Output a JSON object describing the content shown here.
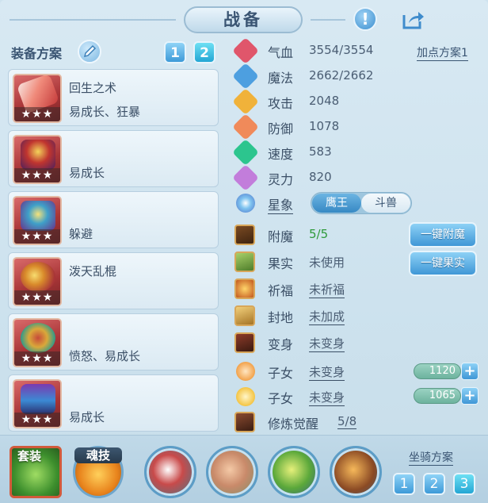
{
  "header": {
    "title": "战备"
  },
  "equipment": {
    "label": "装备方案",
    "tabs": [
      "1",
      "2"
    ],
    "active_tab": "2",
    "items": [
      {
        "name": "回生之术",
        "traits": "易成长、狂暴",
        "stars": "★★★"
      },
      {
        "name": "",
        "traits": "易成长",
        "stars": "★★★"
      },
      {
        "name": "",
        "traits": "躲避",
        "stars": "★★★"
      },
      {
        "name": "泼天乱棍",
        "traits": "",
        "stars": "★★★"
      },
      {
        "name": "",
        "traits": "愤怒、易成长",
        "stars": "★★★"
      },
      {
        "name": "",
        "traits": "易成长",
        "stars": "★★★"
      }
    ]
  },
  "stats": {
    "plan_link": "加点方案1",
    "rows": [
      {
        "name": "气血",
        "value": "3554/3554",
        "icon": "heart-icon",
        "color": "#e0566b"
      },
      {
        "name": "魔法",
        "value": "2662/2662",
        "icon": "mana-icon",
        "color": "#4d9fe0"
      },
      {
        "name": "攻击",
        "value": "2048",
        "icon": "sword-icon",
        "color": "#f0b23a"
      },
      {
        "name": "防御",
        "value": "1078",
        "icon": "shield-icon",
        "color": "#f08a5a"
      },
      {
        "name": "速度",
        "value": "583",
        "icon": "speed-icon",
        "color": "#2cc58e"
      },
      {
        "name": "灵力",
        "value": "820",
        "icon": "spirit-icon",
        "color": "#c27ddb"
      }
    ],
    "constellation": {
      "label": "星象",
      "options": [
        "鹰王",
        "斗兽"
      ],
      "selected": "鹰王"
    }
  },
  "enhance": {
    "rows": [
      {
        "name": "附魔",
        "value": "5/5"
      },
      {
        "name": "果实",
        "value": "未使用"
      },
      {
        "name": "祈福",
        "value": "未祈福"
      },
      {
        "name": "封地",
        "value": "未加成"
      },
      {
        "name": "变身",
        "value": "未变身"
      },
      {
        "name": "子女",
        "value": "未变身"
      },
      {
        "name": "子女",
        "value": "未变身"
      },
      {
        "name": "修炼觉醒",
        "value": "5/8"
      }
    ],
    "buttons": {
      "enchant_all": "一键附魔",
      "fruit_all": "一键果实"
    },
    "child_values": [
      "1120",
      "1065"
    ],
    "value_green": "#2e9a3a"
  },
  "bottom": {
    "set_label": "套装",
    "soul_label": "魂技",
    "mount_label": "坐骑方案",
    "mount_tabs": [
      "1",
      "2",
      "3"
    ],
    "active_mount": "3"
  }
}
